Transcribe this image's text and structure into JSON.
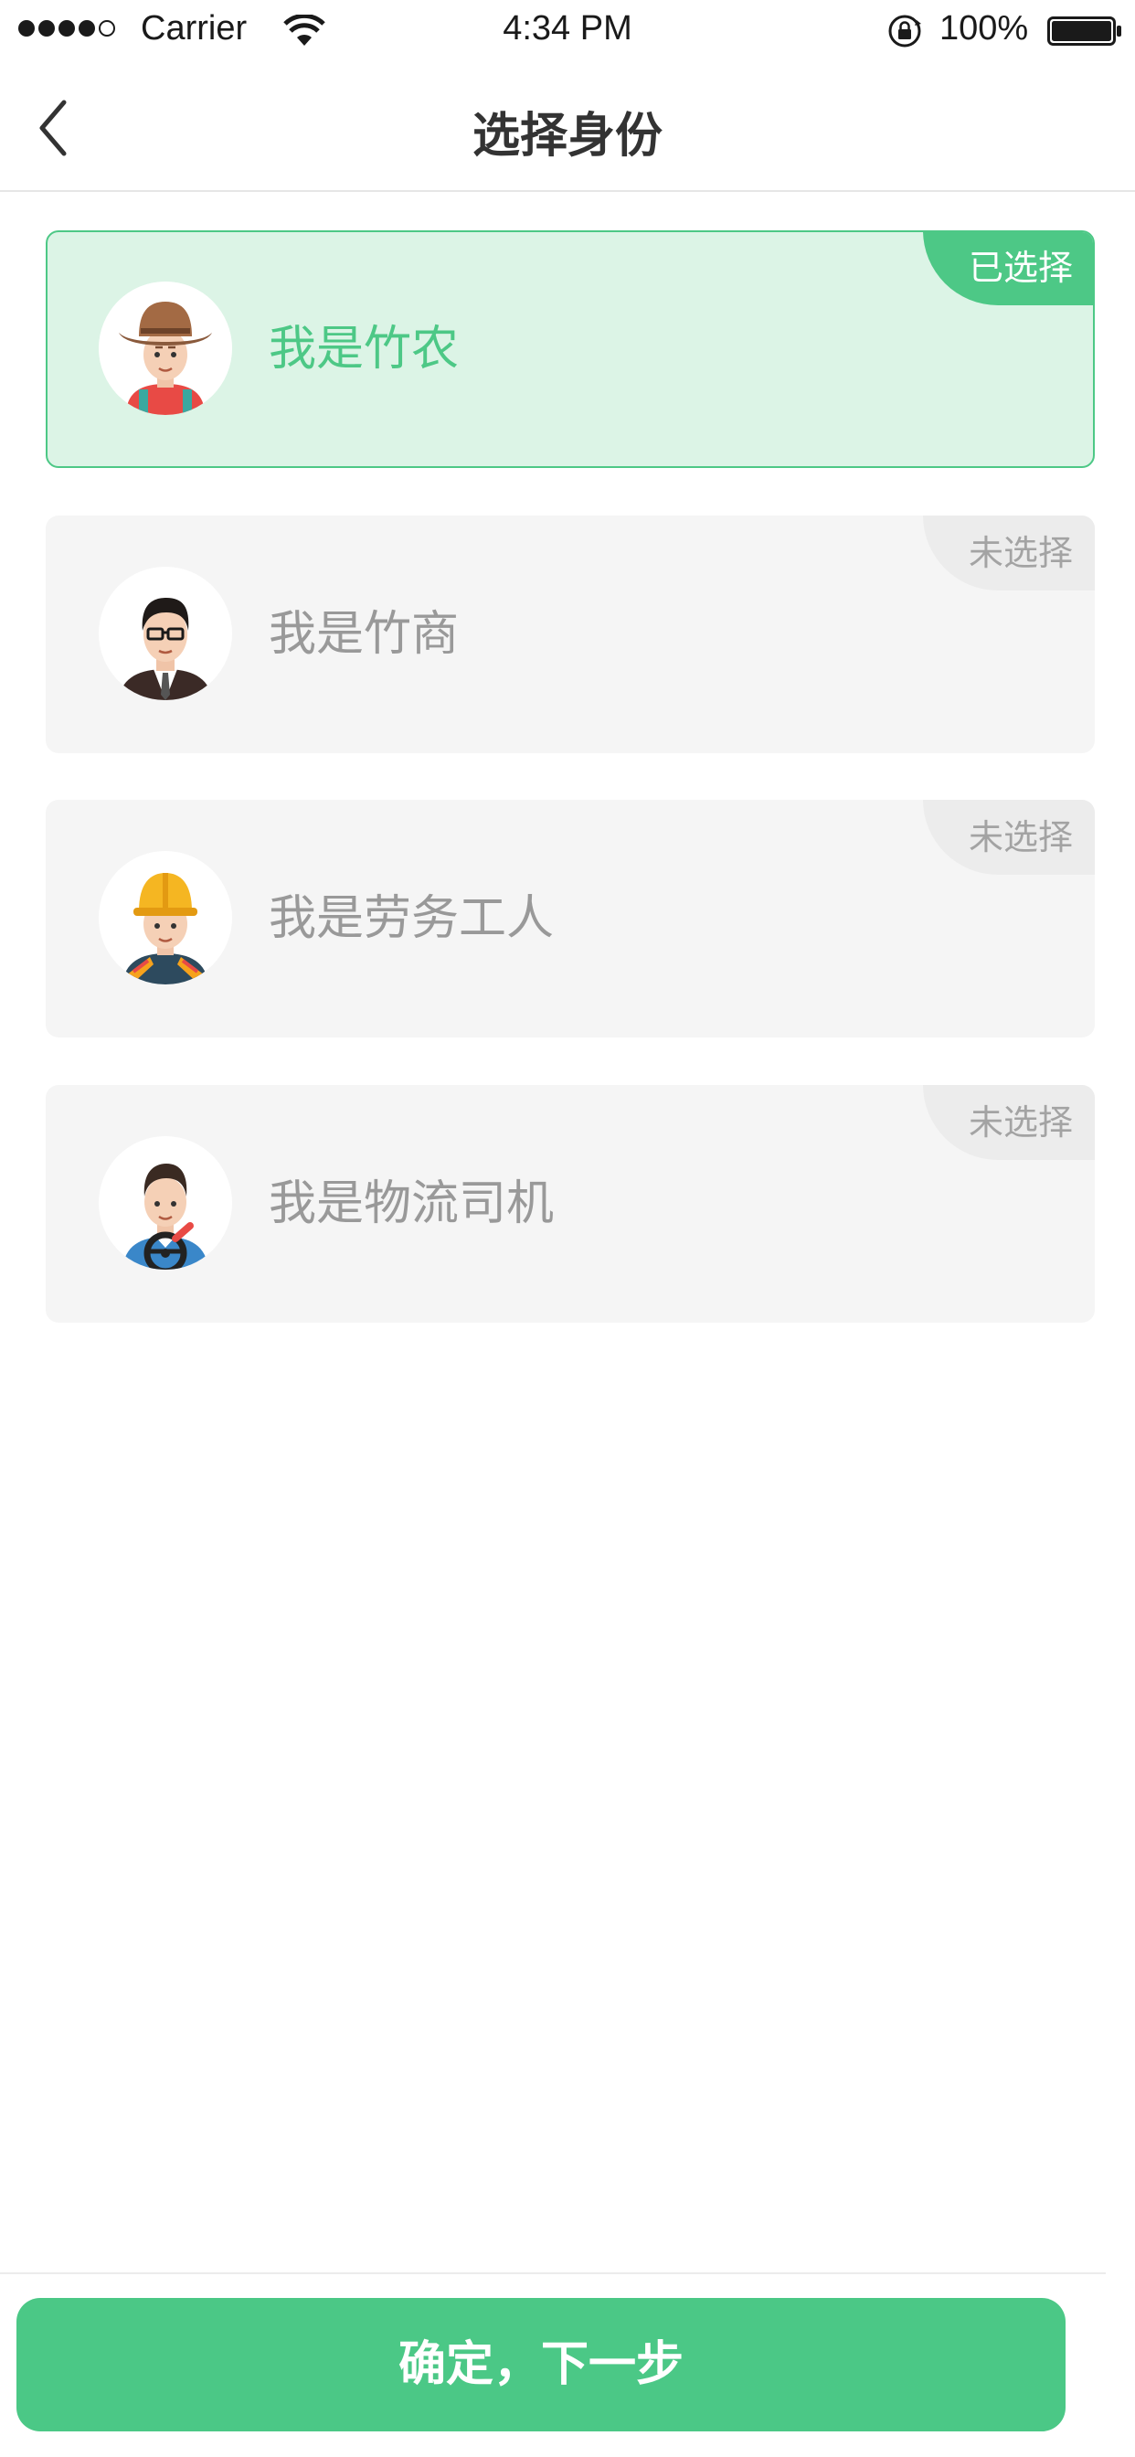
{
  "status_bar": {
    "carrier": "Carrier",
    "time": "4:34 PM",
    "battery": "100%"
  },
  "nav": {
    "title": "选择身份",
    "back_icon": "chevron-left-icon"
  },
  "identities": [
    {
      "label": "我是竹农",
      "badge": "已选择",
      "selected": true,
      "avatar": "farmer-avatar"
    },
    {
      "label": "我是竹商",
      "badge": "未选择",
      "selected": false,
      "avatar": "businessman-avatar"
    },
    {
      "label": "我是劳务工人",
      "badge": "未选择",
      "selected": false,
      "avatar": "worker-avatar"
    },
    {
      "label": "我是物流司机",
      "badge": "未选择",
      "selected": false,
      "avatar": "driver-avatar"
    }
  ],
  "confirm_button": "确定，下一步",
  "colors": {
    "accent": "#4bc886",
    "selected_bg": "#dcf4e6",
    "card_bg": "#f5f5f5"
  }
}
